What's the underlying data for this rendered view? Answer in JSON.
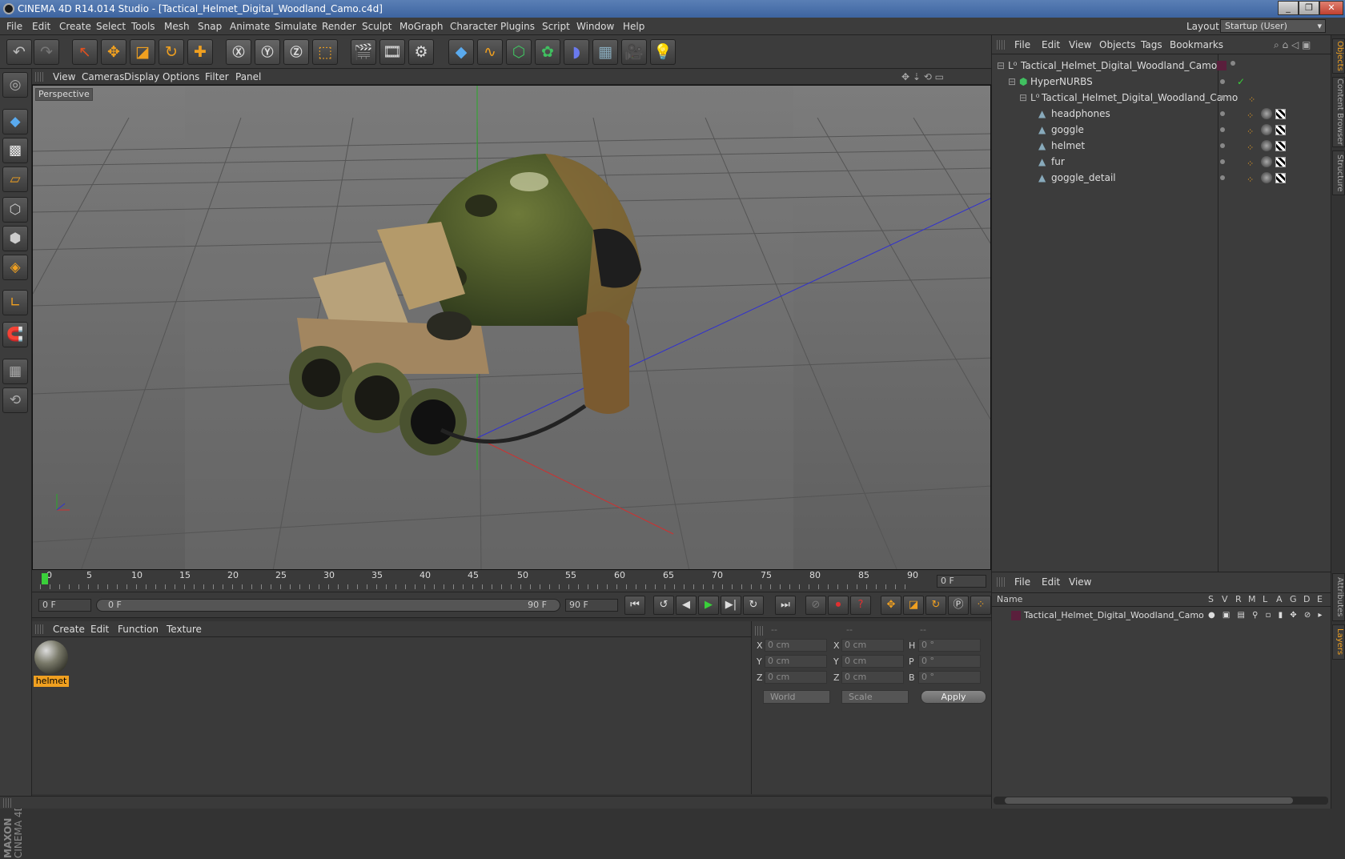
{
  "window": {
    "title": "CINEMA 4D R14.014 Studio - [Tactical_Helmet_Digital_Woodland_Camo.c4d]"
  },
  "menubar": {
    "items": [
      "File",
      "Edit",
      "Create",
      "Select",
      "Tools",
      "Mesh",
      "Snap",
      "Animate",
      "Simulate",
      "Render",
      "Sculpt",
      "MoGraph",
      "Character",
      "Plugins",
      "Script",
      "Window",
      "Help"
    ],
    "layout_label": "Layout:",
    "layout_value": "Startup (User)"
  },
  "viewport": {
    "menu": [
      "View",
      "Cameras",
      "Display",
      "Options",
      "Filter",
      "Panel"
    ],
    "label": "Perspective"
  },
  "timeline": {
    "ticks": [
      "0",
      "5",
      "10",
      "15",
      "20",
      "25",
      "30",
      "35",
      "40",
      "45",
      "50",
      "55",
      "60",
      "65",
      "70",
      "75",
      "80",
      "85",
      "90"
    ],
    "frame_field": "0 F"
  },
  "playback": {
    "start_field": "0 F",
    "slider_start": "0 F",
    "slider_end": "90 F",
    "end_field": "90 F"
  },
  "materials": {
    "menu": [
      "Create",
      "Edit",
      "Function",
      "Texture"
    ],
    "items": [
      {
        "name": "helmet"
      }
    ]
  },
  "coords": {
    "headers": [
      "--",
      "--",
      "--"
    ],
    "rows": [
      {
        "a": "X",
        "v1": "0 cm",
        "b": "X",
        "v2": "0 cm",
        "c": "H",
        "v3": "0 °"
      },
      {
        "a": "Y",
        "v1": "0 cm",
        "b": "Y",
        "v2": "0 cm",
        "c": "P",
        "v3": "0 °"
      },
      {
        "a": "Z",
        "v1": "0 cm",
        "b": "Z",
        "v2": "0 cm",
        "c": "B",
        "v3": "0 °"
      }
    ],
    "world": "World",
    "scale": "Scale",
    "apply": "Apply"
  },
  "objects": {
    "menu": [
      "File",
      "Edit",
      "View",
      "Objects",
      "Tags",
      "Bookmarks"
    ],
    "tree": [
      {
        "name": "Tactical_Helmet_Digital_Woodland_Camo",
        "icon": "null-icon"
      },
      {
        "name": "HyperNURBS",
        "icon": "hypernurbs-icon"
      },
      {
        "name": "Tactical_Helmet_Digital_Woodland_Camo",
        "icon": "null-icon"
      },
      {
        "name": "headphones",
        "icon": "polygon-icon"
      },
      {
        "name": "goggle",
        "icon": "polygon-icon"
      },
      {
        "name": "helmet",
        "icon": "polygon-icon"
      },
      {
        "name": "fur",
        "icon": "polygon-icon"
      },
      {
        "name": "goggle_detail",
        "icon": "polygon-icon"
      }
    ]
  },
  "layers": {
    "menu": [
      "File",
      "Edit",
      "View"
    ],
    "columns": [
      "Name",
      "S",
      "V",
      "R",
      "M",
      "L",
      "A",
      "G",
      "D",
      "E"
    ],
    "rows": [
      {
        "name": "Tactical_Helmet_Digital_Woodland_Camo",
        "color": "#5a1f3c"
      }
    ]
  },
  "side_tabs": {
    "top": [
      "Objects",
      "Content Browser",
      "Structure"
    ],
    "bottom": [
      "Attributes",
      "Layers"
    ]
  },
  "branding": {
    "maxon": "MAXON",
    "product": "CINEMA 4D"
  },
  "colors": {
    "accent": "#f0a020",
    "titlebar": "#3d64a0"
  }
}
